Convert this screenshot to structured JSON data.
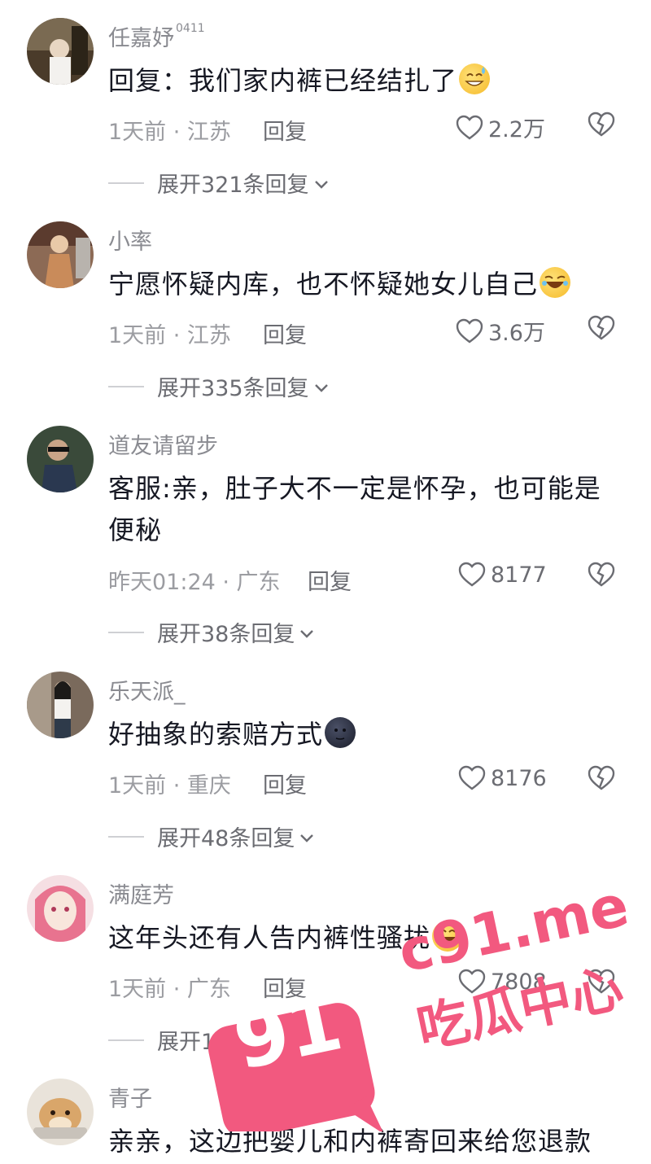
{
  "comments": [
    {
      "username": "任嘉妤",
      "username_sup": "0411",
      "text": "回复：我们家内裤已经结扎了",
      "emoji": "sweat-smile-emoji",
      "time_location": "1天前 · 江苏",
      "reply_label": "回复",
      "likes": "2.2万",
      "expand_label": "展开321条回复"
    },
    {
      "username": "小率",
      "username_sup": "",
      "text": "宁愿怀疑内库，也不怀疑她女儿自己",
      "emoji": "rofl-emoji",
      "time_location": "1天前 · 江苏",
      "reply_label": "回复",
      "likes": "3.6万",
      "expand_label": "展开335条回复"
    },
    {
      "username": "道友请留步",
      "username_sup": "",
      "text": "客服:亲，肚子大不一定是怀孕，也可能是便秘",
      "emoji": "",
      "time_location": "昨天01:24 · 广东",
      "reply_label": "回复",
      "likes": "8177",
      "expand_label": "展开38条回复"
    },
    {
      "username": "乐天派_",
      "username_sup": "",
      "text": "好抽象的索赔方式",
      "emoji": "new-moon-face-emoji",
      "time_location": "1天前 · 重庆",
      "reply_label": "回复",
      "likes": "8176",
      "expand_label": "展开48条回复"
    },
    {
      "username": "满庭芳",
      "username_sup": "",
      "text": "这年头还有人告内裤性骚扰",
      "emoji": "laugh-emoji",
      "time_location": "1天前 · 广东",
      "reply_label": "回复",
      "likes": "7808",
      "expand_label": "展开120条回复"
    },
    {
      "username": "青子",
      "username_sup": "",
      "text": "亲亲，这边把婴儿和内裤寄回来给您退款",
      "emoji": "",
      "time_location": "",
      "reply_label": "",
      "likes": "",
      "expand_label": ""
    }
  ],
  "watermark": {
    "badge": "91",
    "domain": "c91.me",
    "slogan": "吃瓜中心",
    "color": "#f2597f"
  },
  "colors": {
    "text": "#161823",
    "secondary": "#9b9ca1",
    "background": "#ffffff"
  }
}
